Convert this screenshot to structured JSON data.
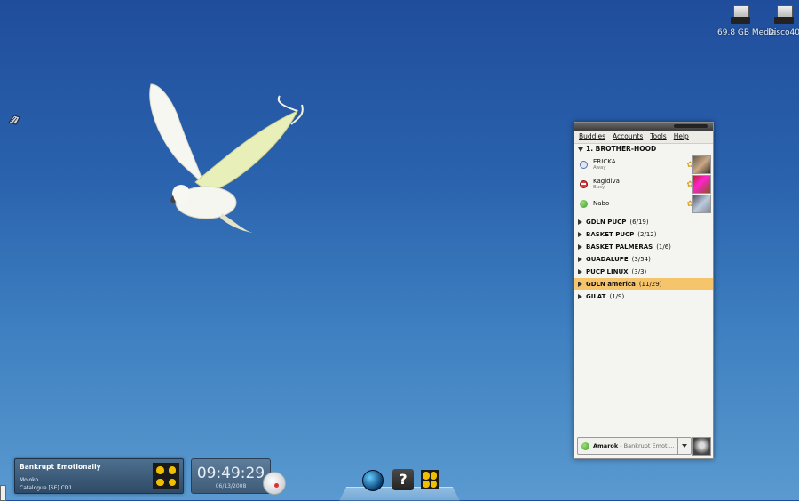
{
  "desktop": {
    "icons": [
      {
        "label": "69.8 GB Media"
      },
      {
        "label": "Disco40"
      }
    ]
  },
  "buddy_list": {
    "menu": [
      "Buddies",
      "Accounts",
      "Tools",
      "Help"
    ],
    "expanded_group": {
      "label": "1. BROTHER-HOOD"
    },
    "buddies": [
      {
        "name": "ERICKA",
        "status": "Away",
        "status_type": "away"
      },
      {
        "name": "Kagidiva",
        "status": "Busy",
        "status_type": "busy"
      },
      {
        "name": "Nabo",
        "status": "",
        "status_type": "available"
      }
    ],
    "groups": [
      {
        "name": "GDLN PUCP",
        "count": "(6/19)"
      },
      {
        "name": "BASKET PUCP",
        "count": "(2/12)"
      },
      {
        "name": "BASKET PALMERAS",
        "count": "(1/6)"
      },
      {
        "name": "GUADALUPE",
        "count": "(3/54)"
      },
      {
        "name": "PUCP LINUX",
        "count": "(3/3)"
      },
      {
        "name": "GDLN america",
        "count": "(11/29)",
        "selected": true
      },
      {
        "name": "GILAT",
        "count": "(1/9)"
      }
    ],
    "status_bar": {
      "name": "Amarok",
      "subtext": " - Bankrupt Emoti..."
    }
  },
  "now_playing": {
    "title": "Bankrupt Emotionally",
    "artist": "Moloko",
    "album": "Catalogue [SE] CD1"
  },
  "clock": {
    "time": "09:49:29",
    "date": "06/13/2008"
  }
}
